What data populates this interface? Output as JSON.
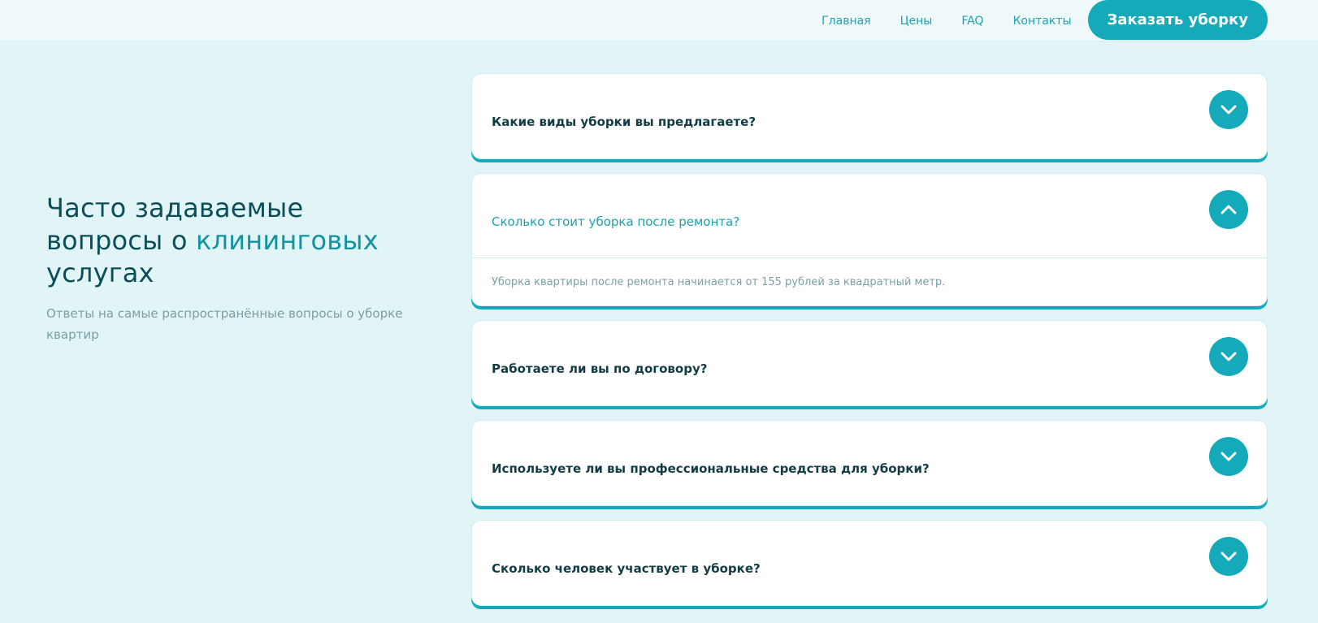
{
  "header": {
    "nav": [
      "Главная",
      "Цены",
      "FAQ",
      "Контакты"
    ],
    "order_button": "Заказать уборку"
  },
  "intro": {
    "title_part1": "Часто задаваемые вопросы о ",
    "title_accent": "клининговых",
    "title_part2": " услугах",
    "subtitle": "Ответы на самые распространённые вопросы о уборке квартир"
  },
  "faq": [
    {
      "question": "Какие виды уборки вы предлагаете?",
      "open": false,
      "icon": "chevron-down-icon"
    },
    {
      "question": "Сколько стоит уборка после ремонта?",
      "open": true,
      "icon": "chevron-up-icon",
      "answer": "Уборка квартиры после ремонта начинается от 155 рублей за квадратный метр."
    },
    {
      "question": "Работаете ли вы по договору?",
      "open": false,
      "icon": "chevron-down-icon"
    },
    {
      "question": "Используете ли вы профессиональные средства для уборки?",
      "open": false,
      "icon": "chevron-down-icon"
    },
    {
      "question": "Сколько человек участвует в уборке?",
      "open": false,
      "icon": "chevron-down-icon"
    }
  ],
  "colors": {
    "accent": "#14aab9",
    "page_background": "#e1f5f6",
    "heading": "#0d4d57",
    "muted_text": "#7b9ea3"
  }
}
